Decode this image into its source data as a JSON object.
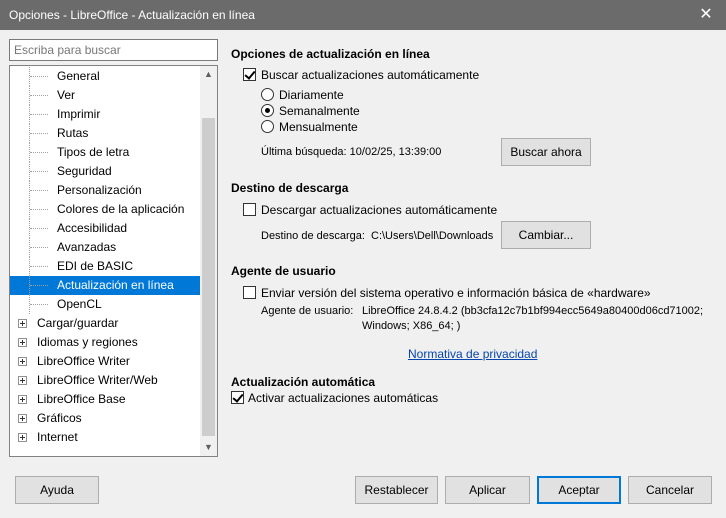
{
  "window": {
    "title": "Opciones - LibreOffice - Actualización en línea"
  },
  "search": {
    "placeholder": "Escriba para buscar"
  },
  "tree": {
    "children": [
      "General",
      "Ver",
      "Imprimir",
      "Rutas",
      "Tipos de letra",
      "Seguridad",
      "Personalización",
      "Colores de la aplicación",
      "Accesibilidad",
      "Avanzadas",
      "EDI de BASIC",
      "Actualización en línea",
      "OpenCL"
    ],
    "selected": "Actualización en línea",
    "parents": [
      "Cargar/guardar",
      "Idiomas y regiones",
      "LibreOffice Writer",
      "LibreOffice Writer/Web",
      "LibreOffice Base",
      "Gráficos",
      "Internet"
    ]
  },
  "online_update": {
    "title": "Opciones de actualización en línea",
    "auto_check_label": "Buscar actualizaciones automáticamente",
    "auto_check": true,
    "frequency": {
      "daily": "Diariamente",
      "weekly": "Semanalmente",
      "monthly": "Mensualmente",
      "selected": "weekly"
    },
    "last_check": "Última búsqueda: 10/02/25, 13:39:00",
    "check_now_button": "Buscar ahora"
  },
  "download": {
    "title": "Destino de descarga",
    "auto_download_label": "Descargar actualizaciones automáticamente",
    "auto_download": false,
    "destination_label": "Destino de descarga:",
    "destination_value": "C:\\Users\\Dell\\Downloads",
    "change_button": "Cambiar..."
  },
  "user_agent": {
    "title": "Agente de usuario",
    "send_label": "Enviar versión del sistema operativo e información básica de «hardware»",
    "send": false,
    "agent_label": "Agente de usuario:",
    "agent_line1": "LibreOffice 24.8.4.2 (bb3cfa12c7b1bf994ecc5649a80400d06cd71002;",
    "agent_line2": "Windows; X86_64; )",
    "privacy_link": "Normativa de privacidad"
  },
  "auto_update": {
    "title": "Actualización automática",
    "enable_label": "Activar actualizaciones automáticas",
    "enable": true
  },
  "footer": {
    "help": "Ayuda",
    "reset": "Restablecer",
    "apply": "Aplicar",
    "ok": "Aceptar",
    "cancel": "Cancelar"
  }
}
